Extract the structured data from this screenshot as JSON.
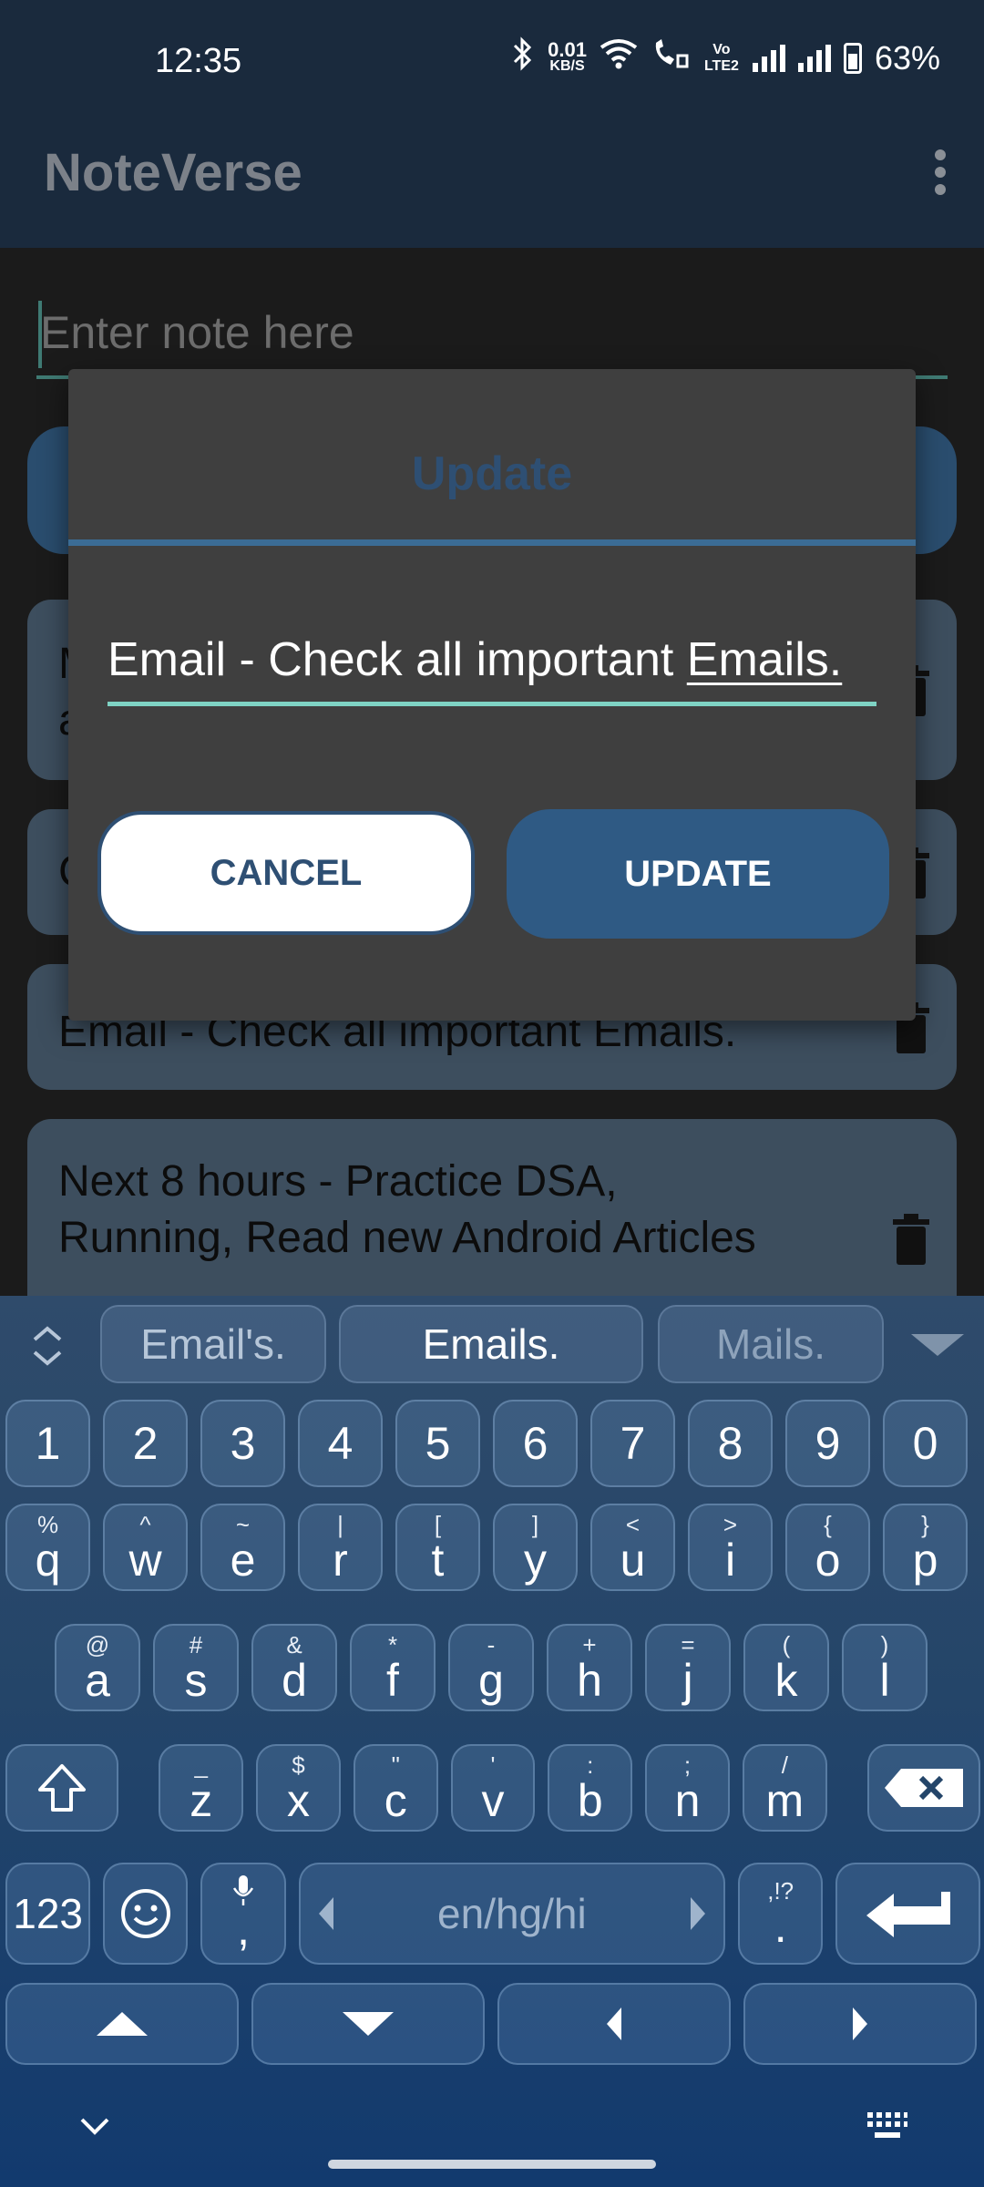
{
  "status_bar": {
    "time": "12:35",
    "net_speed_value": "0.01",
    "net_speed_unit": "KB/S",
    "volte": "Vo LTE2",
    "battery": "63%"
  },
  "app_bar": {
    "title": "NoteVerse"
  },
  "note_input": {
    "placeholder": "Enter note here"
  },
  "notes": [
    {
      "text_line1": "M",
      "text_line2": "a"
    },
    {
      "text_line1": "C",
      "text_line2": ""
    },
    {
      "text_line1": "Email - Check all important Emails.",
      "text_line2": ""
    },
    {
      "text_line1": "Next 8 hours - Practice DSA,",
      "text_line2": "Running, Read new Android Articles"
    }
  ],
  "dialog": {
    "title": "Update",
    "edit_value_prefix": "Email - Check all important ",
    "edit_value_word": "Emails.",
    "cancel_label": "CANCEL",
    "update_label": "UPDATE"
  },
  "keyboard": {
    "suggestions": [
      "Email's.",
      "Emails.",
      "Mails."
    ],
    "number_row": [
      "1",
      "2",
      "3",
      "4",
      "5",
      "6",
      "7",
      "8",
      "9",
      "0"
    ],
    "row1": [
      {
        "main": "q",
        "sub": "%"
      },
      {
        "main": "w",
        "sub": "^"
      },
      {
        "main": "e",
        "sub": "~"
      },
      {
        "main": "r",
        "sub": "|"
      },
      {
        "main": "t",
        "sub": "["
      },
      {
        "main": "y",
        "sub": "]"
      },
      {
        "main": "u",
        "sub": "<"
      },
      {
        "main": "i",
        "sub": ">"
      },
      {
        "main": "o",
        "sub": "{"
      },
      {
        "main": "p",
        "sub": "}"
      }
    ],
    "row2": [
      {
        "main": "a",
        "sub": "@"
      },
      {
        "main": "s",
        "sub": "#"
      },
      {
        "main": "d",
        "sub": "&"
      },
      {
        "main": "f",
        "sub": "*"
      },
      {
        "main": "g",
        "sub": "-"
      },
      {
        "main": "h",
        "sub": "+"
      },
      {
        "main": "j",
        "sub": "="
      },
      {
        "main": "k",
        "sub": "("
      },
      {
        "main": "l",
        "sub": ")"
      }
    ],
    "row3": [
      {
        "main": "z",
        "sub": "_"
      },
      {
        "main": "x",
        "sub": "$"
      },
      {
        "main": "c",
        "sub": "\""
      },
      {
        "main": "v",
        "sub": "'"
      },
      {
        "main": "b",
        "sub": ":"
      },
      {
        "main": "n",
        "sub": ";"
      },
      {
        "main": "m",
        "sub": "/"
      }
    ],
    "symbols_label": "123",
    "comma_label": ",",
    "space_label": "en/hg/hi",
    "period_label": ".",
    "period_sub": ",!?"
  },
  "colors": {
    "app_bar": "#1a2a3d",
    "accent": "#2f5a84",
    "input_underline": "#7fd3c4"
  }
}
